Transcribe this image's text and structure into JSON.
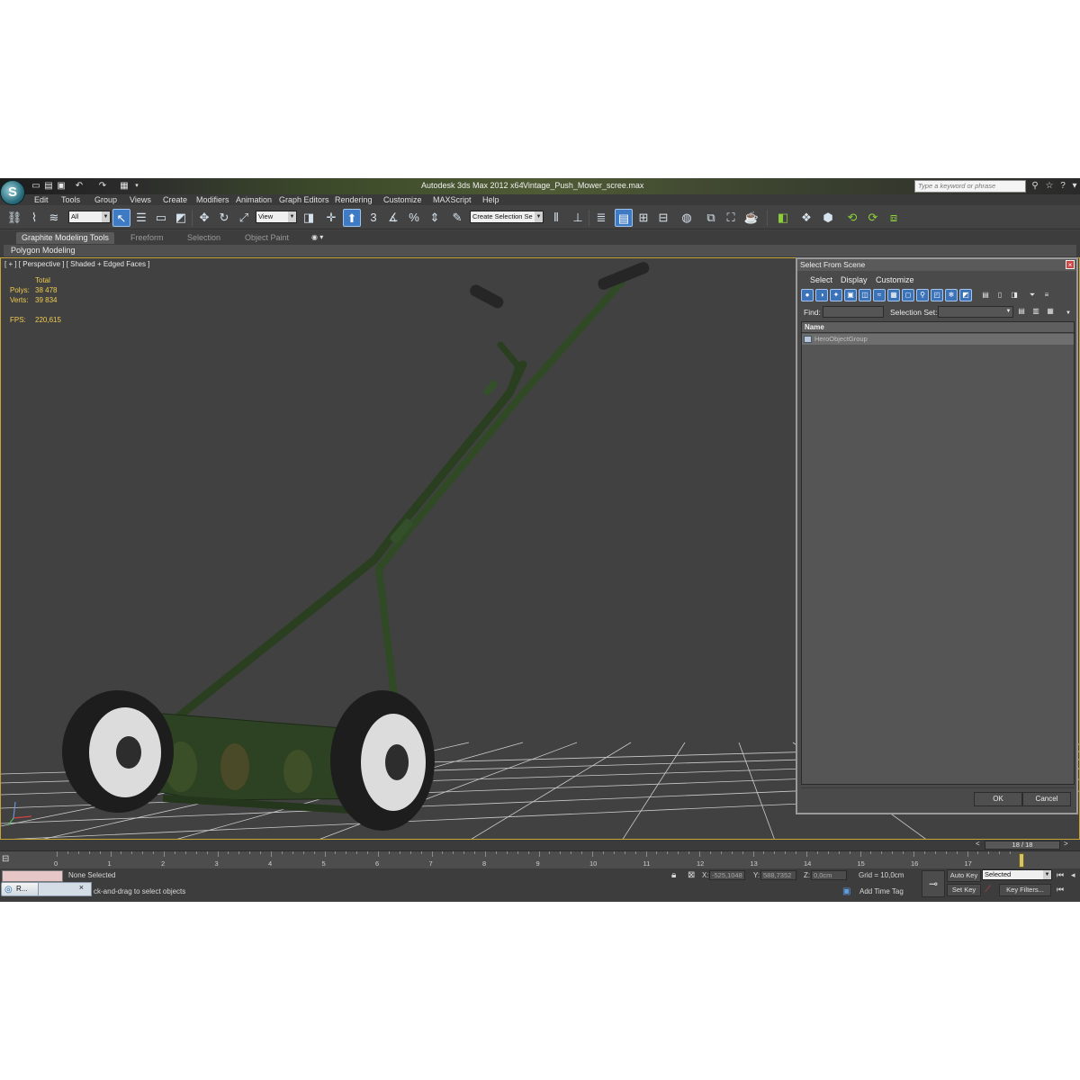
{
  "titlebar": {
    "app_logo": "3ds-max-logo",
    "app_title": "Autodesk 3ds Max  2012 x64",
    "file_name": "Vintage_Push_Mower_scree.max",
    "search_placeholder": "Type a keyword or phrase",
    "quick_access_icons": [
      "new-file-icon",
      "open-file-icon",
      "save-icon",
      "undo-icon",
      "redo-icon",
      "project-folder-icon"
    ]
  },
  "menu": [
    "Edit",
    "Tools",
    "Group",
    "Views",
    "Create",
    "Modifiers",
    "Animation",
    "Graph Editors",
    "Rendering",
    "Customize",
    "MAXScript",
    "Help"
  ],
  "toolbar": {
    "selection_filter": "All",
    "reference_coord": "View",
    "named_selection": "Create Selection Se",
    "snap_label": "3",
    "percent_snap_label": "%"
  },
  "ribbon": {
    "tabs": [
      "Graphite Modeling Tools",
      "Freeform",
      "Selection",
      "Object Paint"
    ],
    "active_tab": "Graphite Modeling Tools",
    "subpanel": "Polygon Modeling"
  },
  "viewport": {
    "label": "[ + ] [ Perspective ] [ Shaded + Edged Faces ]",
    "stats_header": "Total",
    "polys_label": "Polys:",
    "polys_value": "38 478",
    "verts_label": "Verts:",
    "verts_value": "39 834",
    "fps_label": "FPS:",
    "fps_value": "220,615",
    "model": "vintage-push-mower"
  },
  "select_dialog": {
    "title": "Select From Scene",
    "menu": [
      "Select",
      "Display",
      "Customize"
    ],
    "find_label": "Find:",
    "find_value": "",
    "selection_set_label": "Selection Set:",
    "selection_set_value": "",
    "column_header": "Name",
    "rows": [
      "HeroObjectGroup"
    ],
    "ok": "OK",
    "cancel": "Cancel"
  },
  "timeline": {
    "frame_indicator": "18 / 18",
    "frames": [
      "0",
      "1",
      "2",
      "3",
      "4",
      "5",
      "6",
      "7",
      "8",
      "9",
      "10",
      "11",
      "12",
      "13",
      "14",
      "15",
      "16",
      "17"
    ],
    "current_frame": 18
  },
  "status": {
    "selection_status": "None Selected",
    "prompt": "ck-and-drag to select objects",
    "x_label": "X:",
    "x_value": "-525,1048",
    "y_label": "Y:",
    "y_value": "588,7352",
    "z_label": "Z:",
    "z_value": "0,0cm",
    "grid": "Grid = 10,0cm",
    "add_time_tag": "Add Time Tag",
    "auto_key": "Auto Key",
    "set_key": "Set Key",
    "key_mode": "Selected",
    "key_filters": "Key Filters...",
    "taskbar_item": "R..."
  },
  "colors": {
    "viewport_border": "#c6a43a",
    "stats_text": "#f0cc4e",
    "active_tool": "#3f7ac4",
    "mower_green": "#2f4a22"
  }
}
